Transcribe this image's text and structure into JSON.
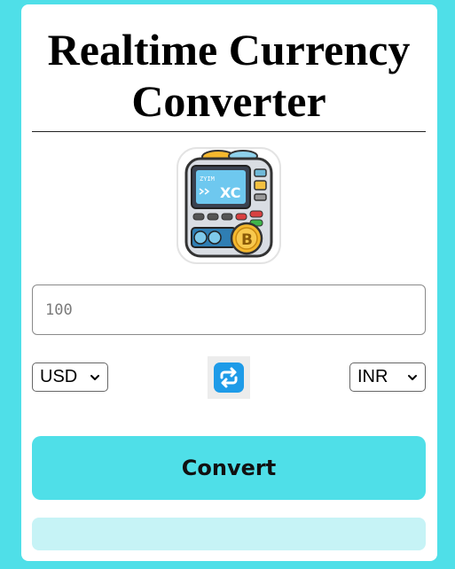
{
  "header": {
    "title_line1": "Realtime Currency",
    "title_line2": "Converter"
  },
  "logo": {
    "icon": "atm-machine-icon",
    "screen_text_small": "ZYIM",
    "screen_text_large": "XC"
  },
  "amount": {
    "placeholder": "100",
    "value": ""
  },
  "from_currency": {
    "selected": "USD"
  },
  "swap": {
    "icon": "swap-arrows-icon"
  },
  "to_currency": {
    "selected": "INR"
  },
  "convert_button": {
    "label": "Convert"
  },
  "result": {
    "text": ""
  },
  "colors": {
    "background": "#4fdfe8",
    "card": "#ffffff",
    "button": "#4fdfe8",
    "result_box": "#c6f3f6",
    "swap_icon": "#1e9be8"
  }
}
